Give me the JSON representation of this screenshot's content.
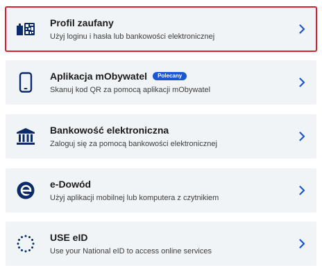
{
  "colors": {
    "accent": "#1c56d2",
    "card_background": "#f1f4f7",
    "selection_outline": "#d91e2e",
    "icon": "#0b2a6b",
    "chevron": "#1c56d2"
  },
  "options": [
    {
      "icon": "trusted-profile-icon",
      "title": "Profil zaufany",
      "description": "Użyj loginu i hasła lub bankowości elektronicznej",
      "badge": "",
      "selected": true
    },
    {
      "icon": "smartphone-icon",
      "title": "Aplikacja mObywatel",
      "description": "Skanuj kod QR za pomocą aplikacji mObywatel",
      "badge": "Polecany",
      "selected": false
    },
    {
      "icon": "bank-icon",
      "title": "Bankowość elektroniczna",
      "description": "Zaloguj się za pomocą bankowości elektronicznej",
      "badge": "",
      "selected": false
    },
    {
      "icon": "e-id-card-icon",
      "title": "e-Dowód",
      "description": "Użyj aplikacji mobilnej lub komputera z czytnikiem",
      "badge": "",
      "selected": false
    },
    {
      "icon": "eu-stars-icon",
      "title": "USE eID",
      "description": "Use your National eID to access online services",
      "badge": "",
      "selected": false
    }
  ]
}
